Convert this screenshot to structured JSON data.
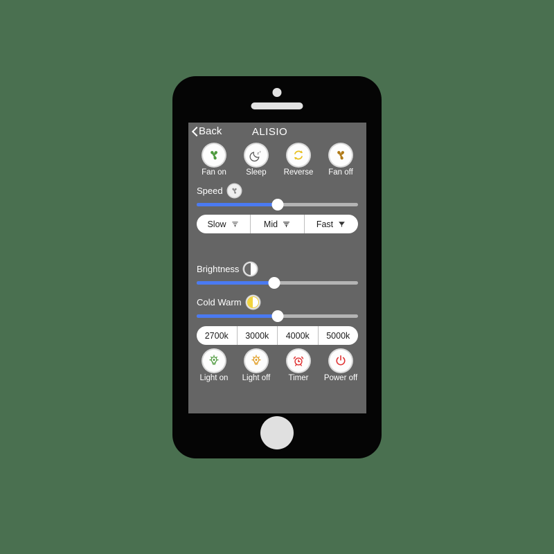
{
  "device": {
    "type": "smartphone",
    "background_color": "#4a7050",
    "body_color": "#050505"
  },
  "header": {
    "back_label": "Back",
    "title": "ALISIO"
  },
  "fan_section": {
    "buttons": [
      {
        "label": "Fan on",
        "icon": "fan-icon",
        "color": "#4e9a3e"
      },
      {
        "label": "Sleep",
        "icon": "moon-sleep-icon",
        "color": "#555555"
      },
      {
        "label": "Reverse",
        "icon": "reverse-arrows-icon",
        "color": "#e8c020"
      },
      {
        "label": "Fan off",
        "icon": "fan-icon",
        "color": "#b07a18"
      }
    ],
    "speed": {
      "label": "Speed",
      "icon": "fan-small-icon",
      "value_percent": 50,
      "fill_color": "#4a7af2",
      "track_color": "#b4b4b4"
    },
    "modes": [
      {
        "label": "Slow",
        "icon": "wind-light-icon"
      },
      {
        "label": "Mid",
        "icon": "wind-medium-icon"
      },
      {
        "label": "Fast",
        "icon": "wind-strong-icon"
      }
    ]
  },
  "light_section": {
    "brightness": {
      "label": "Brightness",
      "icon": "half-circle-bw-icon",
      "value_percent": 48,
      "fill_color": "#4a7af2",
      "track_color": "#b4b4b4"
    },
    "cold_warm": {
      "label": "Cold Warm",
      "icon": "half-circle-warm-icon",
      "icon_color": "#f2d43c",
      "value_percent": 50,
      "fill_color": "#4a7af2",
      "track_color": "#b4b4b4"
    },
    "temperatures": [
      {
        "label": "2700k"
      },
      {
        "label": "3000k"
      },
      {
        "label": "4000k"
      },
      {
        "label": "5000k"
      }
    ],
    "buttons": [
      {
        "label": "Light on",
        "icon": "bulb-icon",
        "color": "#4e9a3e"
      },
      {
        "label": "Light off",
        "icon": "bulb-icon",
        "color": "#e09a1e"
      },
      {
        "label": "Timer",
        "icon": "alarm-clock-icon",
        "color": "#e03030"
      },
      {
        "label": "Power off",
        "icon": "power-icon",
        "color": "#e03030"
      }
    ]
  }
}
